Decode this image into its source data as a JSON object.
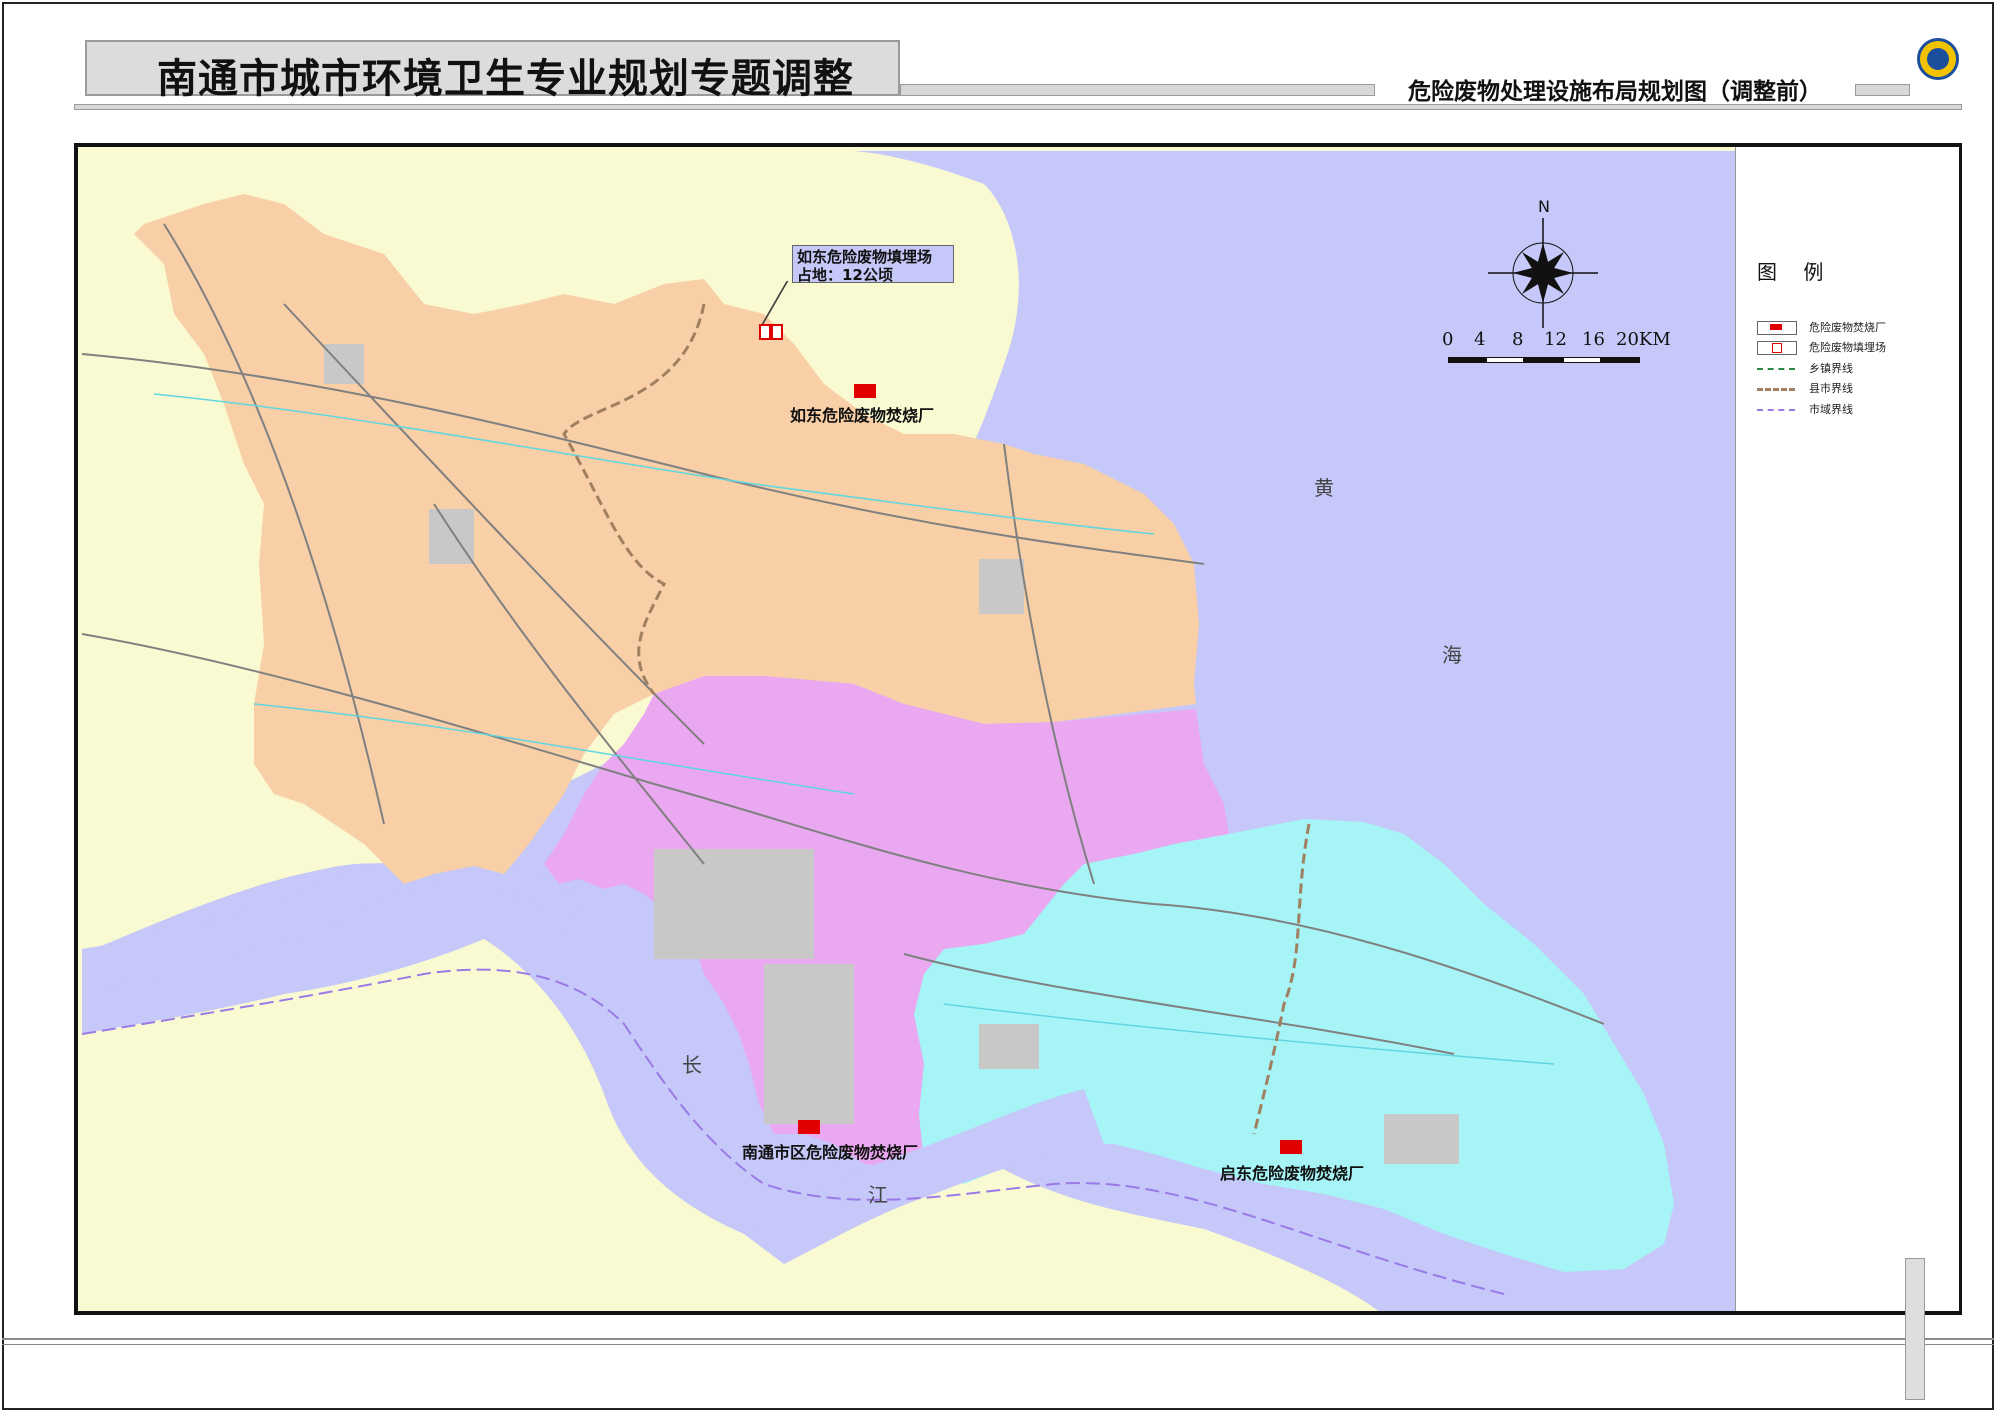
{
  "header": {
    "title": "南通市城市环境卫生专业规划专题调整",
    "subtitle": "危险废物处理设施布局规划图（调整前）"
  },
  "compass": {
    "north_label": "N"
  },
  "scale_bar": {
    "labels": [
      "0",
      "4",
      "8",
      "12",
      "16",
      "20KM"
    ]
  },
  "legend": {
    "title": "图 例",
    "items": [
      {
        "label": "危险废物焚烧厂",
        "swatch": "incinerator"
      },
      {
        "label": "危险废物填埋场",
        "swatch": "landfill"
      },
      {
        "label": "乡镇界线",
        "swatch": "town-boundary"
      },
      {
        "label": "县市界线",
        "swatch": "county-boundary"
      },
      {
        "label": "市域界线",
        "swatch": "city-boundary"
      }
    ]
  },
  "sea_labels": {
    "huang": "黄",
    "hai": "海",
    "chang": "长",
    "jiang": "江"
  },
  "facilities": {
    "landfill_name": "如东危险废物填埋场",
    "landfill_area": "占地：12公顷",
    "rudong_incinerator": "如东危险废物焚烧厂",
    "nantong_incinerator": "南通市区危险废物焚烧厂",
    "qidong_incinerator": "启东危险废物焚烧厂"
  },
  "colors": {
    "sea": "#c5c8f8",
    "rudong_rugao": "#f8cfa6",
    "nantong_urban": "#e9a8f0",
    "qidong_haimen": "#a6f4f6",
    "land_other": "#fafad2",
    "urban_grey": "#c8c8c8",
    "water_cyan": "#5fd6e0",
    "road_grey": "#808080",
    "facility_red": "#e00000"
  }
}
